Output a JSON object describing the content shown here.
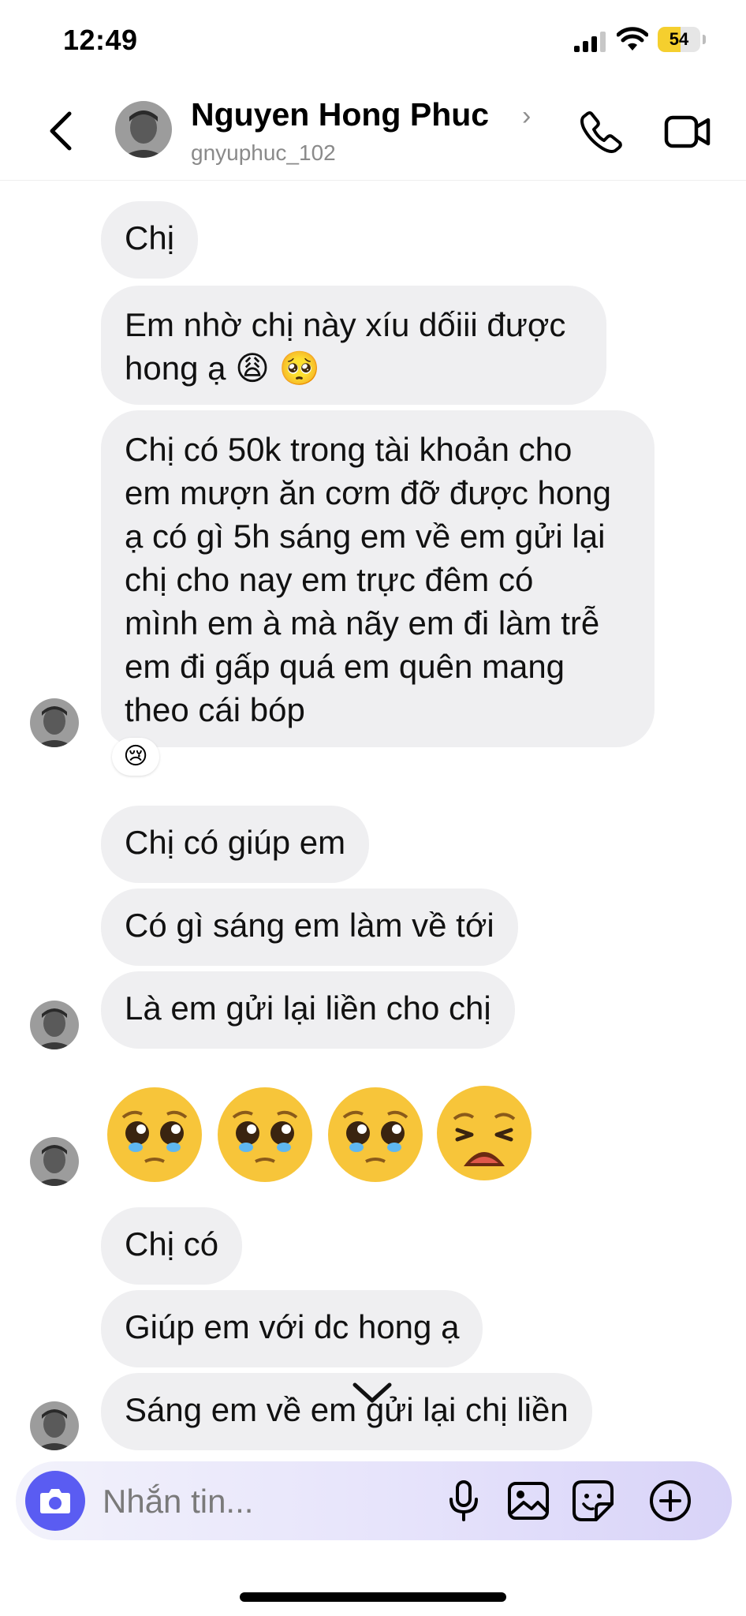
{
  "status_bar": {
    "time": "12:49",
    "battery": "54",
    "battery_level": 0.54
  },
  "header": {
    "name": "Nguyen Hong Phuc",
    "name_chevron": "›",
    "username": "gnyuphuc_102"
  },
  "messages": [
    {
      "text": "Chị"
    },
    {
      "text": "Em nhờ chị này xíu dốiii được hong ạ 😩 🥺",
      "lines": [
        "Em nhờ chị này xíu dốiii được",
        "hong ạ 😩 🥺"
      ]
    },
    {
      "text": "Chị có 50k trong tài khoản cho em mượn ăn cơm đỡ được hong ạ có gì 5h sáng em về em gửi lại chị cho nay em trực đêm có mình em à mà nãy em đi làm trễ em đi gấp quá em quên mang theo cái bóp",
      "lines": [
        "Chị có 50k trong tài khoản cho",
        "em mượn ăn cơm đỡ được hong",
        "ạ có gì 5h sáng em về em gửi lại",
        "chị cho nay em trực đêm có",
        "mình em à mà nãy em đi làm trễ",
        "em đi gấp quá em quên mang",
        "theo cái bóp"
      ],
      "reaction": "😢"
    },
    {
      "text": "Chị có giúp em"
    },
    {
      "text": "Có gì sáng em làm về tới"
    },
    {
      "text": "Là em gửi lại liền cho chị"
    },
    {
      "text": "Chị có"
    },
    {
      "text": "Giúp em với dc hong ạ"
    },
    {
      "text": "Sáng em về em gửi lại chị liền"
    }
  ],
  "emoji_row": [
    "pleading-face",
    "pleading-face",
    "pleading-face",
    "weary-face"
  ],
  "composer": {
    "placeholder": "Nhắn tin..."
  },
  "colors": {
    "accent": "#5a5cf2",
    "bubble": "#efeff1",
    "emoji_face": "#f7c53a"
  }
}
